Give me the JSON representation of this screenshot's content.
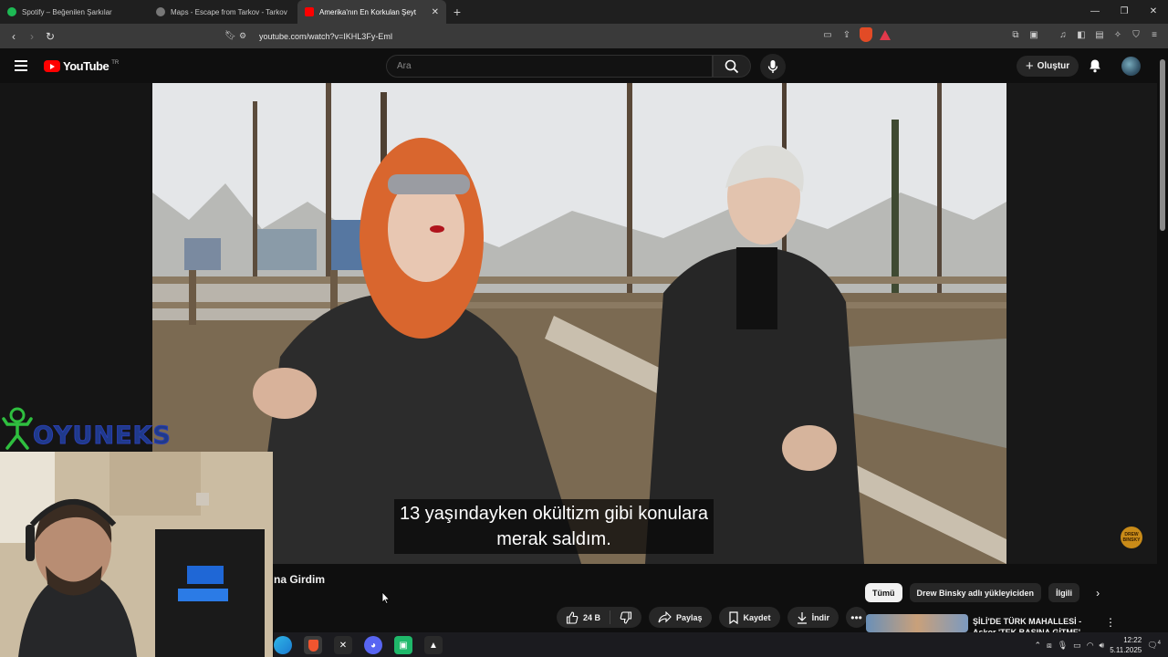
{
  "browser": {
    "tabs": [
      {
        "title": "Spotify – Beğenilen Şarkılar",
        "favicon": "spotify-icon",
        "active": false
      },
      {
        "title": "Maps - Escape from Tarkov - Tarkov",
        "favicon": "tarkov-icon",
        "active": false
      },
      {
        "title": "Amerika'nın En Korkulan Şeyt",
        "favicon": "youtube-icon",
        "active": true
      }
    ],
    "url": "youtube.com/watch?v=IKHL3Fy-EmI",
    "window_controls": [
      "—",
      "❐",
      "✕"
    ]
  },
  "youtube": {
    "logo_text": "YouTube",
    "region": "TR",
    "search_placeholder": "Ara",
    "create_label": "Oluştur"
  },
  "video": {
    "subtitle_line1": "13 yaşındayken okültizm gibi konulara",
    "subtitle_line2": "merak saldım.",
    "channel_badge": "DREW BINSKY"
  },
  "overlay": {
    "brand": "OYUNEKS"
  },
  "below": {
    "title_fragment": "na Girdim",
    "like_count": "24 B",
    "share_label": "Paylaş",
    "save_label": "Kaydet",
    "download_label": "İndir"
  },
  "chips": [
    {
      "label": "Tümü",
      "selected": true
    },
    {
      "label": "Drew Binsky adlı yükleyiciden",
      "selected": false
    },
    {
      "label": "İlgili",
      "selected": false
    }
  ],
  "recommendation": {
    "title_line1": "ŞİLİ'DE TÜRK MAHALLESİ -",
    "title_line2": "Askor 'TEK BAŞINA GİTME'"
  },
  "taskbar": {
    "time": "12:22",
    "date": "5.11.2025",
    "notification_count": "4"
  },
  "colors": {
    "youtube_red": "#ff0000",
    "background": "#0f0f0f",
    "chip_bg": "#272727"
  }
}
